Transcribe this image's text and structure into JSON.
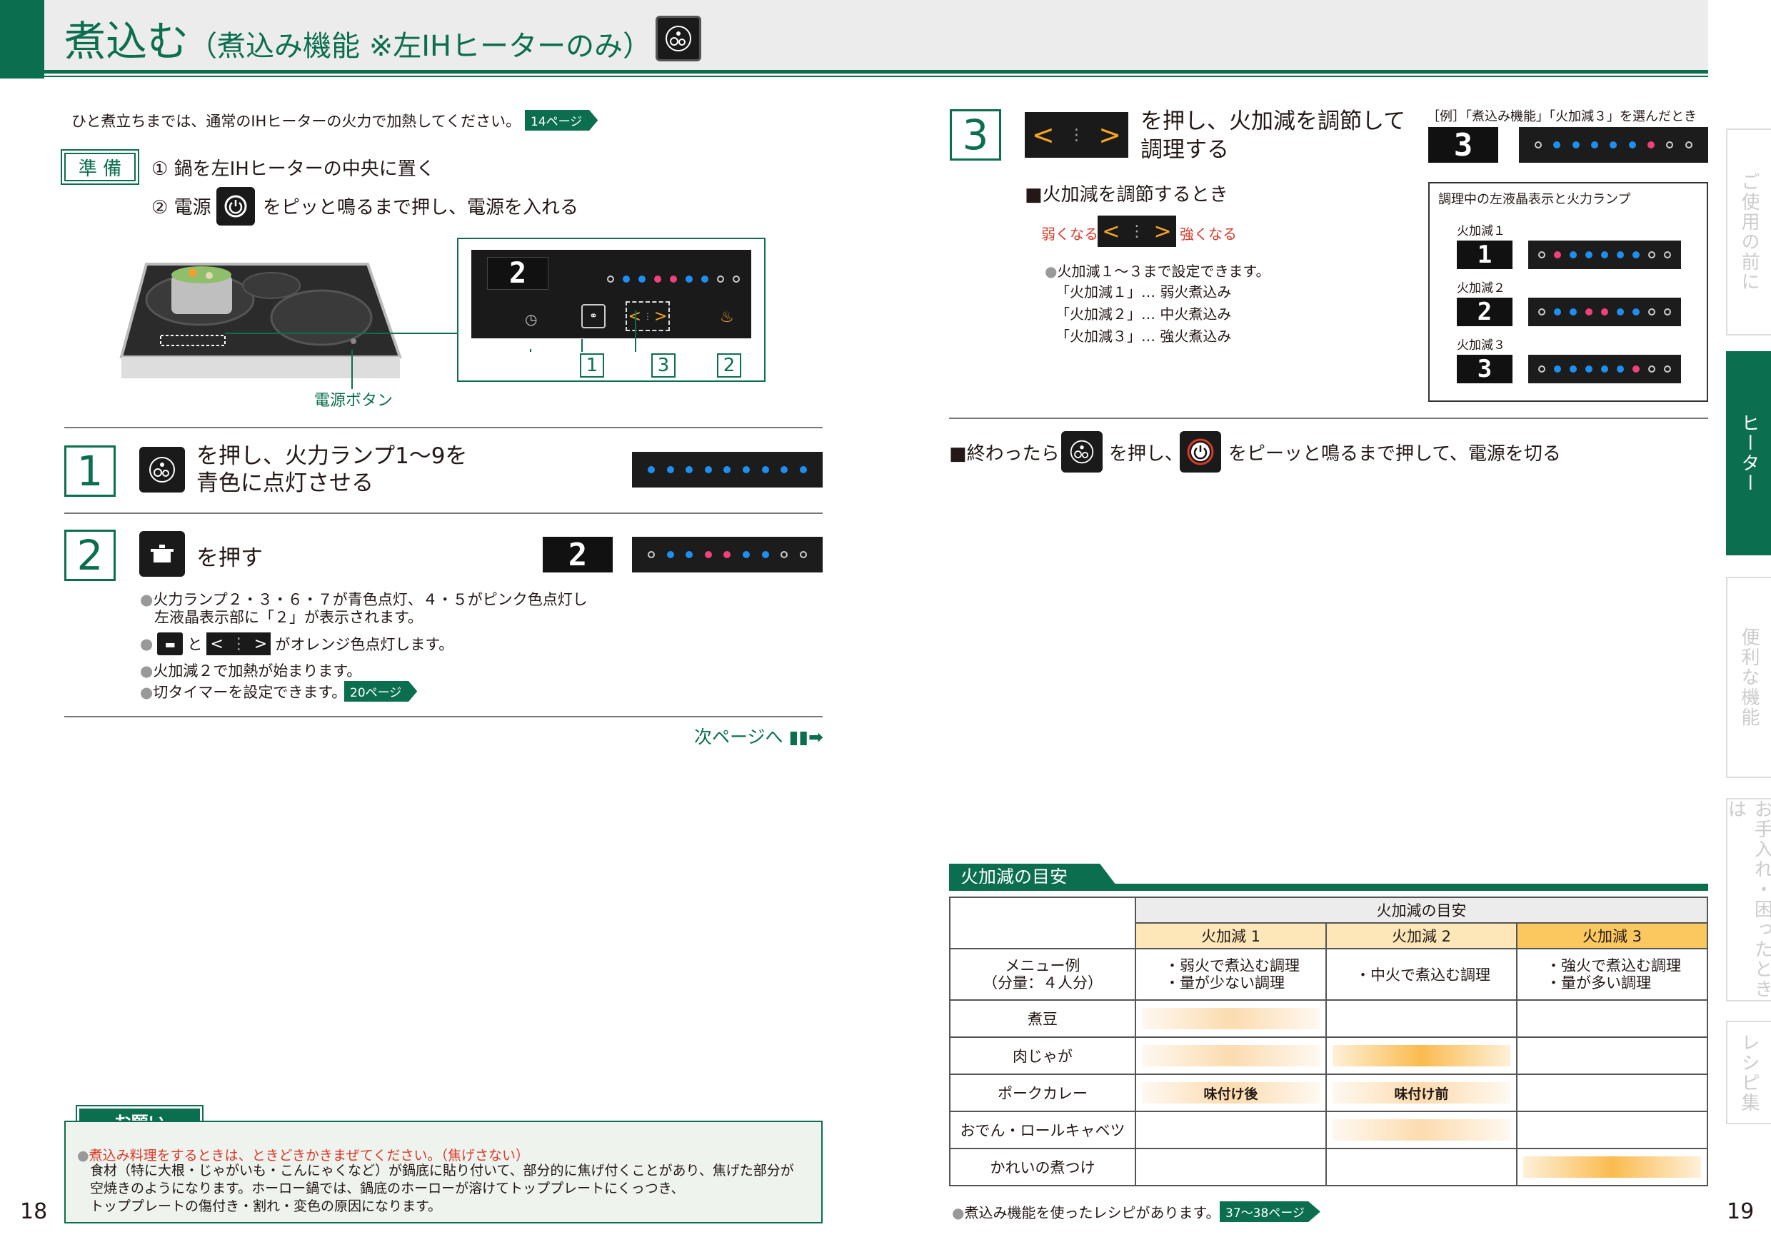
{
  "header": {
    "title_main": "煮込む",
    "title_sub": "（煮込み機能 ※左IHヒーターのみ）"
  },
  "left": {
    "intro": "ひと煮立ちまでは、通常のIHヒーターの火力で加熱してください。",
    "intro_ref": "14ページ",
    "prep_label": "準 備",
    "prep1": "① 鍋を左IHヒーターの中央に置く",
    "prep2_a": "② 電源",
    "prep2_b": "をピッと鳴るまで押し、電源を入れる",
    "panel_lcd": "2",
    "panel_labels": [
      "1",
      "3",
      "2"
    ],
    "power_label": "電源ボタン",
    "step1_num": "1",
    "step1_text_a": "を押し、火力ランプ1～9を",
    "step1_text_b": "青色に点灯させる",
    "step2_num": "2",
    "step2_text": "を押す",
    "step2_lcd": "2",
    "notes": [
      "火力ランプ２・３・６・７が青色点灯、４・５がピンク色点灯し",
      "左液晶表示部に「２」が表示されます。",
      "がオレンジ色点灯します。",
      "火加減２で加熱が始まります。",
      "切タイマーを設定できます。"
    ],
    "note_and": "と",
    "timer_ref": "20ページ",
    "next_page": "次ページへ",
    "onegai_title": "お願い",
    "onegai_red": "煮込み料理をするときは、ときどきかきまぜてください。（焦げさない）",
    "onegai_lines": [
      "食材（特に大根・じゃがいも・こんにゃくなど）が鍋底に貼り付いて、部分的に焦げ付くことがあり、焦げた部分が",
      "空焼きのようになります。ホーロー鍋では、鍋底のホーローが溶けてトッププレートにくっつき、",
      "トッププレートの傷付き・割れ・変色の原因になります。"
    ],
    "page_num": "18"
  },
  "right": {
    "step3_num": "3",
    "step3_text_a": "を押し、火加減を調節して",
    "step3_text_b": "調理する",
    "example_caption": "［例］「煮込み機能」「火加減３」を選んだとき",
    "example_lcd": "3",
    "adjust_heading": "■火加減を調節するとき",
    "weaker": "弱くなる",
    "stronger": "強くなる",
    "range_note": "火加減１～３まで設定できます。",
    "levels_desc": [
      "「火加減１」… 弱火煮込み",
      "「火加減２」… 中火煮込み",
      "「火加減３」… 強火煮込み"
    ],
    "box_title": "調理中の左液晶表示と火力ランプ",
    "box_levels": [
      {
        "label": "火加減１",
        "lcd": "1"
      },
      {
        "label": "火加減２",
        "lcd": "2"
      },
      {
        "label": "火加減３",
        "lcd": "3"
      }
    ],
    "finish_a": "■終わったら",
    "finish_b": "を押し、",
    "finish_c": "をピーッと鳴るまで押して、電源を切る",
    "guide_title": "火加減の目安",
    "table": {
      "header_group": "火加減の目安",
      "cols": [
        "火加減 1",
        "火加減 2",
        "火加減 3"
      ],
      "menu_label_a": "メニュー例",
      "menu_label_b": "（分量：４人分）",
      "menu_examples": [
        [
          "・弱火で煮込む調理",
          "・量が少ない調理"
        ],
        [
          "・中火で煮込む調理"
        ],
        [
          "・強火で煮込む調理",
          "・量が多い調理"
        ]
      ],
      "rows": [
        {
          "name": "煮豆",
          "levels": [
            1,
            0,
            0
          ],
          "labels": [
            "",
            "",
            ""
          ]
        },
        {
          "name": "肉じゃが",
          "levels": [
            1,
            2,
            0
          ],
          "labels": [
            "",
            "",
            ""
          ]
        },
        {
          "name": "ポークカレー",
          "levels": [
            1,
            1,
            0
          ],
          "labels": [
            "味付け後",
            "味付け前",
            ""
          ]
        },
        {
          "name": "おでん・ロールキャベツ",
          "levels": [
            0,
            1,
            0
          ],
          "labels": [
            "",
            "",
            ""
          ]
        },
        {
          "name": "かれいの煮つけ",
          "levels": [
            0,
            0,
            2
          ],
          "labels": [
            "",
            "",
            ""
          ]
        }
      ]
    },
    "recipe_note": "煮込み機能を使ったレシピがあります。",
    "recipe_ref": "37～38ページ",
    "page_num": "19"
  },
  "tabs": [
    "ご使用の前に",
    "ヒーター",
    "便利な機能",
    "お手入れ・困ったときは",
    "レシピ集"
  ],
  "colors": {
    "brand": "#0b6e4f",
    "lamp_blue": "#1e8ff0",
    "lamp_pink": "#f0407e",
    "orange": "#f5a623"
  }
}
